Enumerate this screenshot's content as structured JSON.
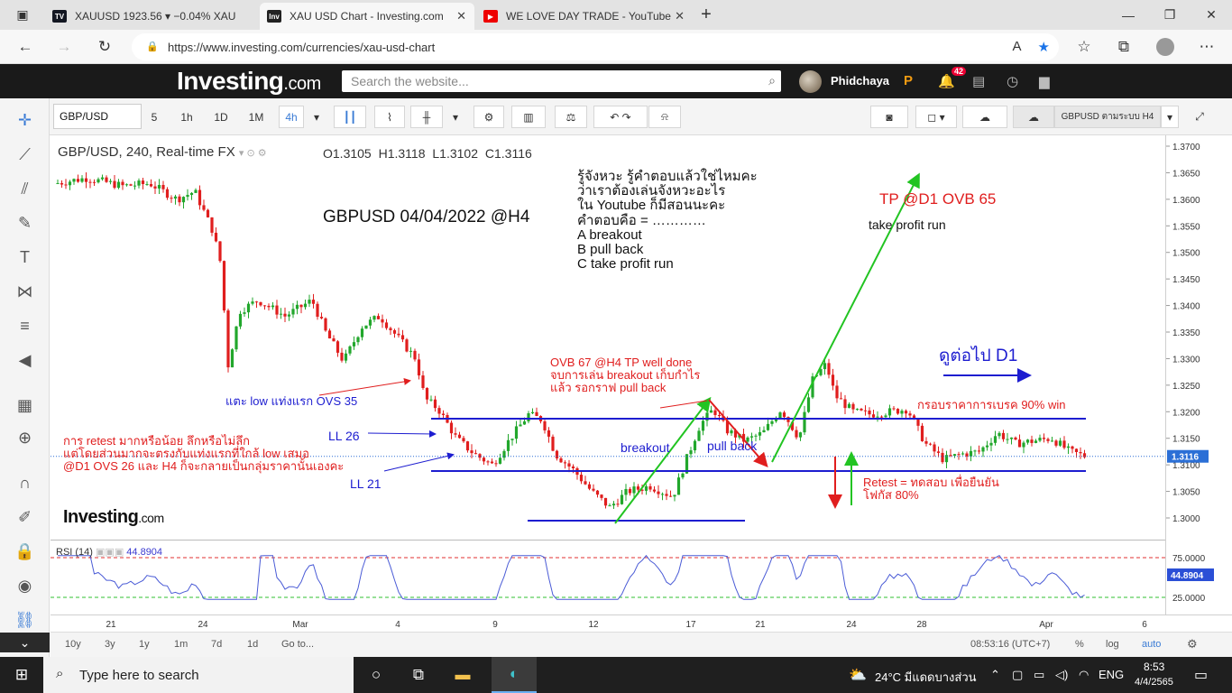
{
  "browser": {
    "tabs": [
      {
        "label": "XAUUSD 1923.56 ▾ −0.04% XAU",
        "favicon": "TV"
      },
      {
        "label": "XAU USD Chart - Investing.com",
        "favicon": "Inv"
      },
      {
        "label": "WE LOVE DAY TRADE - YouTube",
        "favicon": "▶"
      }
    ],
    "url": "https://www.investing.com/currencies/xau-usd-chart"
  },
  "site": {
    "logo": "Investing",
    "logo_suffix": ".com",
    "search_placeholder": "Search the website...",
    "username": "Phidchaya",
    "notifications": "42"
  },
  "toolbar": {
    "symbol": "GBP/USD",
    "intervals": [
      "5",
      "1h",
      "1D",
      "1M",
      "4h"
    ],
    "layout_label": "GBPUSD ตามระบบ H4"
  },
  "chart": {
    "title": "GBP/USD, 240, Real-time FX",
    "ohlc": "O1.3105  H1.3118  L1.3102  C1.3116",
    "price_labels": [
      "1.3700",
      "1.3650",
      "1.3600",
      "1.3550",
      "1.3500",
      "1.3450",
      "1.3400",
      "1.3350",
      "1.3300",
      "1.3250",
      "1.3200",
      "1.3150",
      "1.3100",
      "1.3050",
      "1.3000"
    ],
    "last_price": "1.3116",
    "rsi_label": "RSI (14)",
    "rsi_value": "44.8904",
    "rsi_levels": [
      "75.0000",
      "25.0000"
    ],
    "rsi_current": "44.8904",
    "date_labels": [
      "21",
      "24",
      "Mar",
      "4",
      "9",
      "12",
      "17",
      "21",
      "24",
      "28",
      "Apr",
      "6"
    ],
    "watermark": "Investing",
    "watermark_suffix": ".com"
  },
  "annotations": {
    "heading": "GBPUSD 04/04/2022 @H4",
    "quiz": "รู้จังหวะ รู้คำตอบแล้วใช่ไหมคะ\nว่าเราต้องเล่นจังหวะอะไร\nใน Youtube ก็มีสอนนะคะ\nคำตอบคือ = …………\nA breakout\nB pull back\nC take profit run",
    "tp": "TP @D1 OVB 65",
    "take_profit_run": "take profit run",
    "d1": "ดูต่อไป D1",
    "ovb67": "OVB 67 @H4 TP well done\nจบการเล่น breakout เก็บกำไร\nแล้ว รอกราฟ pull back",
    "ovs35": "แตะ low แท่งแรก OVS 35",
    "frame": "กรอบราคาการเบรค 90% win",
    "ll26": "LL 26",
    "ll21": "LL 21",
    "retest_note": "การ retest มากหรือน้อย ลึกหรือไม่ลึก\nแต่โดยส่วนมากจะตรงกับแท่งแรกที่ใกล้ low เสมอ\n@D1 OVS 26 และ H4 ก็จะกลายเป็นกลุ่มราคานั้นเองคะ",
    "breakout": "breakout",
    "pullback": "pull back",
    "retest": "Retest = ทดสอบ เพื่อยืนยัน\nโฟกัส 80%"
  },
  "bottombar": {
    "ranges": [
      "10y",
      "3y",
      "1y",
      "1m",
      "7d",
      "1d",
      "Go to..."
    ],
    "clock": "08:53:16 (UTC+7)",
    "opts": [
      "%",
      "log",
      "auto"
    ]
  },
  "taskbar": {
    "search": "Type here to search",
    "weather": "24°C  มีแดดบางส่วน",
    "lang": "ENG",
    "time": "8:53",
    "date": "4/4/2565"
  },
  "colors": {
    "accent": "#3a7bd5",
    "up": "#22a72c",
    "down": "#e01e1e",
    "line": "#1d1dd0"
  }
}
